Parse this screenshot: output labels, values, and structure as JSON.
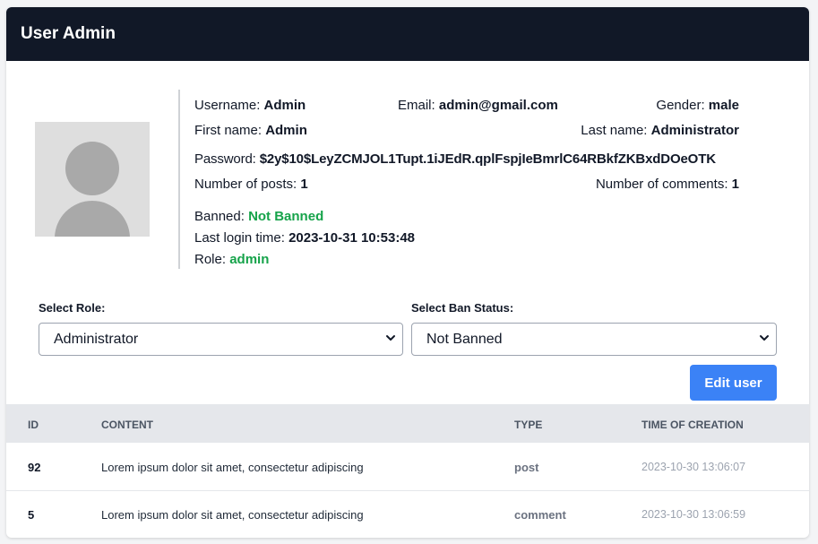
{
  "header": {
    "title": "User Admin"
  },
  "profile": {
    "username_label": "Username:",
    "username": "Admin",
    "email_label": "Email:",
    "email": "admin@gmail.com",
    "gender_label": "Gender:",
    "gender": "male",
    "first_name_label": "First name:",
    "first_name": "Admin",
    "last_name_label": "Last name:",
    "last_name": "Administrator",
    "password_label": "Password:",
    "password": "$2y$10$LeyZCMJOL1Tupt.1iJEdR.qplFspjIeBmrlC64RBkfZKBxdDOeOTK",
    "posts_label": "Number of posts:",
    "posts": "1",
    "comments_label": "Number of comments:",
    "comments": "1",
    "banned_label": "Banned:",
    "banned": "Not Banned",
    "last_login_label": "Last login time:",
    "last_login": "2023-10-31 10:53:48",
    "role_label": "Role:",
    "role": "admin"
  },
  "form": {
    "role_label": "Select Role:",
    "role_value": "Administrator",
    "ban_label": "Select Ban Status:",
    "ban_value": "Not Banned",
    "submit_label": "Edit user"
  },
  "table": {
    "columns": [
      "ID",
      "CONTENT",
      "TYPE",
      "TIME OF CREATION"
    ],
    "rows": [
      {
        "id": "92",
        "content": "Lorem ipsum dolor sit amet, consectetur adipiscing",
        "type": "post",
        "time": "2023-10-30 13:06:07"
      },
      {
        "id": "5",
        "content": "Lorem ipsum dolor sit amet, consectetur adipiscing",
        "type": "comment",
        "time": "2023-10-30 13:06:59"
      }
    ]
  },
  "colors": {
    "header_bg": "#111827",
    "accent": "#3b82f6",
    "success": "#16a34a"
  }
}
